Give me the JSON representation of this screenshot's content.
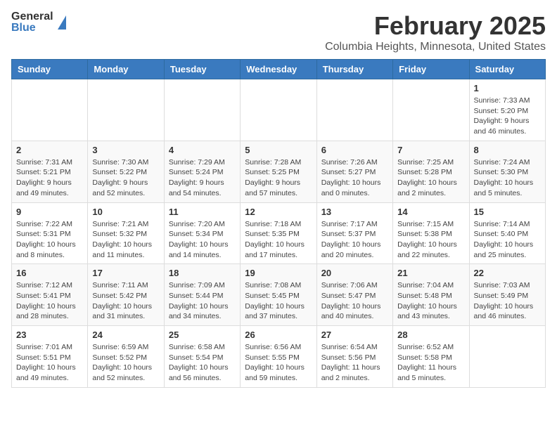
{
  "header": {
    "logo_general": "General",
    "logo_blue": "Blue",
    "month": "February 2025",
    "location": "Columbia Heights, Minnesota, United States"
  },
  "days_of_week": [
    "Sunday",
    "Monday",
    "Tuesday",
    "Wednesday",
    "Thursday",
    "Friday",
    "Saturday"
  ],
  "weeks": [
    [
      {
        "day": "",
        "info": ""
      },
      {
        "day": "",
        "info": ""
      },
      {
        "day": "",
        "info": ""
      },
      {
        "day": "",
        "info": ""
      },
      {
        "day": "",
        "info": ""
      },
      {
        "day": "",
        "info": ""
      },
      {
        "day": "1",
        "info": "Sunrise: 7:33 AM\nSunset: 5:20 PM\nDaylight: 9 hours and 46 minutes."
      }
    ],
    [
      {
        "day": "2",
        "info": "Sunrise: 7:31 AM\nSunset: 5:21 PM\nDaylight: 9 hours and 49 minutes."
      },
      {
        "day": "3",
        "info": "Sunrise: 7:30 AM\nSunset: 5:22 PM\nDaylight: 9 hours and 52 minutes."
      },
      {
        "day": "4",
        "info": "Sunrise: 7:29 AM\nSunset: 5:24 PM\nDaylight: 9 hours and 54 minutes."
      },
      {
        "day": "5",
        "info": "Sunrise: 7:28 AM\nSunset: 5:25 PM\nDaylight: 9 hours and 57 minutes."
      },
      {
        "day": "6",
        "info": "Sunrise: 7:26 AM\nSunset: 5:27 PM\nDaylight: 10 hours and 0 minutes."
      },
      {
        "day": "7",
        "info": "Sunrise: 7:25 AM\nSunset: 5:28 PM\nDaylight: 10 hours and 2 minutes."
      },
      {
        "day": "8",
        "info": "Sunrise: 7:24 AM\nSunset: 5:30 PM\nDaylight: 10 hours and 5 minutes."
      }
    ],
    [
      {
        "day": "9",
        "info": "Sunrise: 7:22 AM\nSunset: 5:31 PM\nDaylight: 10 hours and 8 minutes."
      },
      {
        "day": "10",
        "info": "Sunrise: 7:21 AM\nSunset: 5:32 PM\nDaylight: 10 hours and 11 minutes."
      },
      {
        "day": "11",
        "info": "Sunrise: 7:20 AM\nSunset: 5:34 PM\nDaylight: 10 hours and 14 minutes."
      },
      {
        "day": "12",
        "info": "Sunrise: 7:18 AM\nSunset: 5:35 PM\nDaylight: 10 hours and 17 minutes."
      },
      {
        "day": "13",
        "info": "Sunrise: 7:17 AM\nSunset: 5:37 PM\nDaylight: 10 hours and 20 minutes."
      },
      {
        "day": "14",
        "info": "Sunrise: 7:15 AM\nSunset: 5:38 PM\nDaylight: 10 hours and 22 minutes."
      },
      {
        "day": "15",
        "info": "Sunrise: 7:14 AM\nSunset: 5:40 PM\nDaylight: 10 hours and 25 minutes."
      }
    ],
    [
      {
        "day": "16",
        "info": "Sunrise: 7:12 AM\nSunset: 5:41 PM\nDaylight: 10 hours and 28 minutes."
      },
      {
        "day": "17",
        "info": "Sunrise: 7:11 AM\nSunset: 5:42 PM\nDaylight: 10 hours and 31 minutes."
      },
      {
        "day": "18",
        "info": "Sunrise: 7:09 AM\nSunset: 5:44 PM\nDaylight: 10 hours and 34 minutes."
      },
      {
        "day": "19",
        "info": "Sunrise: 7:08 AM\nSunset: 5:45 PM\nDaylight: 10 hours and 37 minutes."
      },
      {
        "day": "20",
        "info": "Sunrise: 7:06 AM\nSunset: 5:47 PM\nDaylight: 10 hours and 40 minutes."
      },
      {
        "day": "21",
        "info": "Sunrise: 7:04 AM\nSunset: 5:48 PM\nDaylight: 10 hours and 43 minutes."
      },
      {
        "day": "22",
        "info": "Sunrise: 7:03 AM\nSunset: 5:49 PM\nDaylight: 10 hours and 46 minutes."
      }
    ],
    [
      {
        "day": "23",
        "info": "Sunrise: 7:01 AM\nSunset: 5:51 PM\nDaylight: 10 hours and 49 minutes."
      },
      {
        "day": "24",
        "info": "Sunrise: 6:59 AM\nSunset: 5:52 PM\nDaylight: 10 hours and 52 minutes."
      },
      {
        "day": "25",
        "info": "Sunrise: 6:58 AM\nSunset: 5:54 PM\nDaylight: 10 hours and 56 minutes."
      },
      {
        "day": "26",
        "info": "Sunrise: 6:56 AM\nSunset: 5:55 PM\nDaylight: 10 hours and 59 minutes."
      },
      {
        "day": "27",
        "info": "Sunrise: 6:54 AM\nSunset: 5:56 PM\nDaylight: 11 hours and 2 minutes."
      },
      {
        "day": "28",
        "info": "Sunrise: 6:52 AM\nSunset: 5:58 PM\nDaylight: 11 hours and 5 minutes."
      },
      {
        "day": "",
        "info": ""
      }
    ]
  ]
}
